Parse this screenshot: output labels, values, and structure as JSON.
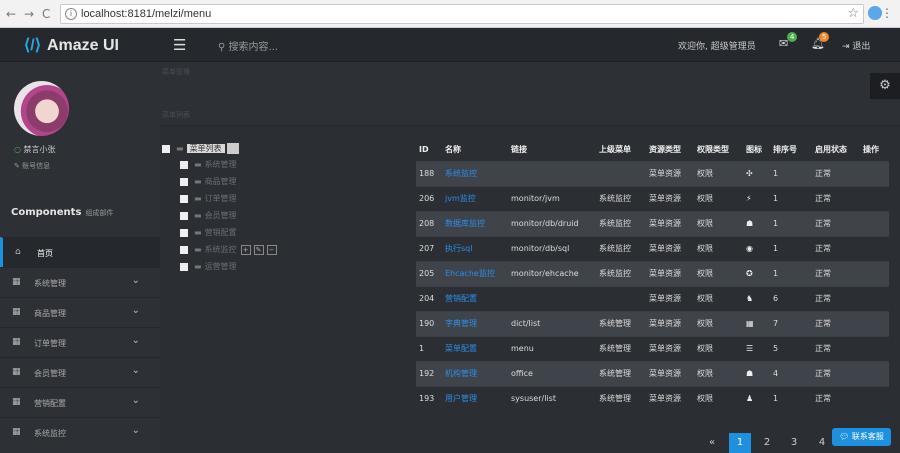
{
  "browser": {
    "url": "localhost:8181/melzi/menu",
    "back": "←",
    "forward": "→",
    "reload": "C",
    "star": "☆",
    "menu": "⋮"
  },
  "header": {
    "logo_text": "Amaze UI",
    "search_placeholder": "搜索内容...",
    "welcome": "欢迎你, 超级管理员",
    "mail_badge": "4",
    "bell_badge": "5",
    "logout": "退出",
    "badge_colors": {
      "mail": "#4caf50",
      "bell": "#f0862a"
    }
  },
  "sidebar": {
    "user_name": "禁言小张",
    "user_profile": "账号信息",
    "components_title": "Components",
    "components_sub": "组成部件",
    "items": [
      {
        "label": "首页",
        "icon": "home-icon",
        "active": true
      },
      {
        "label": "系统管理",
        "icon": "table-icon"
      },
      {
        "label": "商品管理",
        "icon": "table-icon"
      },
      {
        "label": "订单管理",
        "icon": "table-icon"
      },
      {
        "label": "会员管理",
        "icon": "table-icon"
      },
      {
        "label": "营销配置",
        "icon": "table-icon"
      },
      {
        "label": "系统监控",
        "icon": "table-icon"
      }
    ]
  },
  "main": {
    "breadcrumb": "菜单管理",
    "page_heading": "菜单列表"
  },
  "tree": {
    "root": "菜单列表",
    "nodes": [
      "系统管理",
      "商品管理",
      "订单管理",
      "会员管理",
      "营销配置",
      "系统监控",
      "运营管理"
    ]
  },
  "table": {
    "headers": [
      "ID",
      "名称",
      "链接",
      "上级菜单",
      "资源类型",
      "权限类型",
      "图标",
      "排序号",
      "启用状态",
      "操作"
    ],
    "rows": [
      {
        "id": "188",
        "name": "系统监控",
        "link": "",
        "parent": "",
        "type": "菜单资源",
        "perm": "权限",
        "icon": "✣",
        "order": "1",
        "status": "正常"
      },
      {
        "id": "206",
        "name": "jvm监控",
        "link": "monitor/jvm",
        "parent": "系统监控",
        "type": "菜单资源",
        "perm": "权限",
        "icon": "⚡",
        "order": "1",
        "status": "正常"
      },
      {
        "id": "208",
        "name": "数据库监控",
        "link": "monitor/db/druid",
        "parent": "系统监控",
        "type": "菜单资源",
        "perm": "权限",
        "icon": "☗",
        "order": "1",
        "status": "正常"
      },
      {
        "id": "207",
        "name": "执行sql",
        "link": "monitor/db/sql",
        "parent": "系统监控",
        "type": "菜单资源",
        "perm": "权限",
        "icon": "◉",
        "order": "1",
        "status": "正常"
      },
      {
        "id": "205",
        "name": "Ehcache监控",
        "link": "monitor/ehcache",
        "parent": "系统监控",
        "type": "菜单资源",
        "perm": "权限",
        "icon": "✪",
        "order": "1",
        "status": "正常"
      },
      {
        "id": "204",
        "name": "营销配置",
        "link": "",
        "parent": "",
        "type": "菜单资源",
        "perm": "权限",
        "icon": "♞",
        "order": "6",
        "status": "正常"
      },
      {
        "id": "190",
        "name": "字典管理",
        "link": "dict/list",
        "parent": "系统管理",
        "type": "菜单资源",
        "perm": "权限",
        "icon": "▦",
        "order": "7",
        "status": "正常"
      },
      {
        "id": "1",
        "name": "菜单配置",
        "link": "menu",
        "parent": "系统管理",
        "type": "菜单资源",
        "perm": "权限",
        "icon": "☰",
        "order": "5",
        "status": "正常"
      },
      {
        "id": "192",
        "name": "机构管理",
        "link": "office",
        "parent": "系统管理",
        "type": "菜单资源",
        "perm": "权限",
        "icon": "☗",
        "order": "4",
        "status": "正常"
      },
      {
        "id": "193",
        "name": "用户管理",
        "link": "sysuser/list",
        "parent": "系统管理",
        "type": "菜单资源",
        "perm": "权限",
        "icon": "♟",
        "order": "1",
        "status": "正常"
      }
    ]
  },
  "pager": {
    "prev": "«",
    "pages": [
      "1",
      "2",
      "3",
      "4"
    ],
    "active": "1"
  },
  "chat_button": "联系客服"
}
